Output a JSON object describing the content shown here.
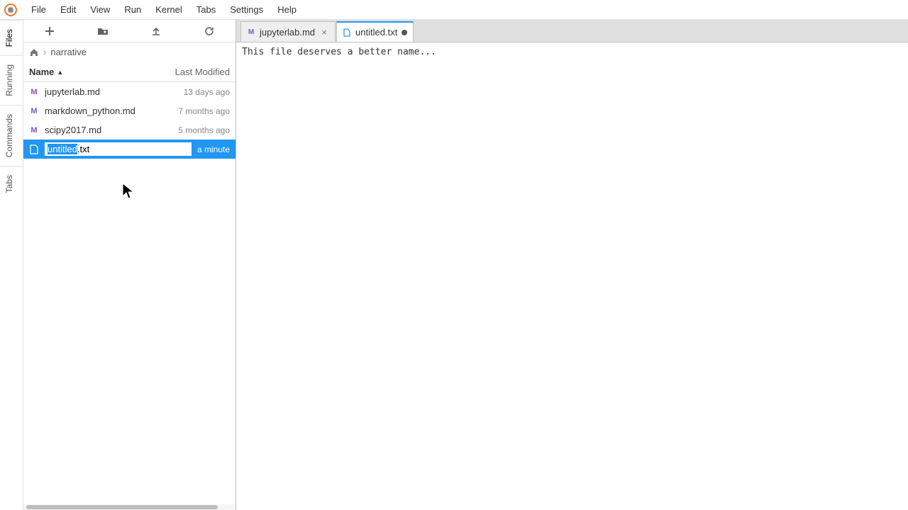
{
  "menu": [
    "File",
    "Edit",
    "View",
    "Run",
    "Kernel",
    "Tabs",
    "Settings",
    "Help"
  ],
  "side_tabs": [
    "Files",
    "Running",
    "Commands",
    "Tabs"
  ],
  "breadcrumb": {
    "root_icon": "home",
    "sep": "›",
    "path": "narrative"
  },
  "fb_header": {
    "name": "Name",
    "modified": "Last Modified"
  },
  "files": [
    {
      "icon": "md",
      "name": "jupyterlab.md",
      "modified": "13 days ago",
      "selected": false
    },
    {
      "icon": "md",
      "name": "markdown_python.md",
      "modified": "7 months ago",
      "selected": false
    },
    {
      "icon": "md",
      "name": "scipy2017.md",
      "modified": "5 months ago",
      "selected": false
    },
    {
      "icon": "txt",
      "name": "untitled.txt",
      "modified": "a minute",
      "selected": true,
      "renaming": true
    }
  ],
  "rename_value": "untitled.txt",
  "dock_tabs": [
    {
      "label": "jupyterlab.md",
      "icon": "md",
      "active": false,
      "dirty": false
    },
    {
      "label": "untitled.txt",
      "icon": "txt",
      "active": true,
      "dirty": true
    }
  ],
  "editor_content": "This file deserves a better name..."
}
